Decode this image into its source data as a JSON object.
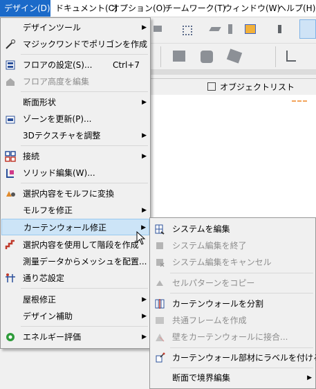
{
  "menubar": [
    {
      "label": "デザイン(D)",
      "active": true
    },
    {
      "label": "ドキュメント(C)"
    },
    {
      "label": "オプション(O)"
    },
    {
      "label": "チームワーク(T)"
    },
    {
      "label": "ウィンドウ(W)"
    },
    {
      "label": "ヘルプ(H)"
    }
  ],
  "background": {
    "object_list_label": "オブジェクトリスト"
  },
  "design_menu": {
    "items": [
      {
        "label": "デザインツール",
        "submenu": true,
        "icon": "none"
      },
      {
        "label": "マジックワンドでポリゴンを作成",
        "icon": "magic-wand-icon"
      },
      {
        "label": "フロアの設定(S)...",
        "shortcut": "Ctrl+7",
        "icon": "floor-settings-icon"
      },
      {
        "label": "フロア高度を編集",
        "disabled": true,
        "icon": "floor-height-icon"
      },
      {
        "label": "断面形状",
        "submenu": true,
        "icon": "none"
      },
      {
        "label": "ゾーンを更新(P)...",
        "icon": "zone-update-icon"
      },
      {
        "label": "3Dテクスチャを調整",
        "submenu": true,
        "icon": "none"
      },
      {
        "label": "接続",
        "submenu": true,
        "icon": "connect-icon"
      },
      {
        "label": "ソリッド編集(W)...",
        "icon": "solid-edit-icon"
      },
      {
        "label": "選択内容をモルフに変換",
        "icon": "convert-morph-icon"
      },
      {
        "label": "モルフを修正",
        "submenu": true,
        "icon": "none"
      },
      {
        "label": "カーテンウォール修正",
        "submenu": true,
        "highlighted": true,
        "icon": "none"
      },
      {
        "label": "選択内容を使用して階段を作成",
        "icon": "stair-icon"
      },
      {
        "label": "測量データからメッシュを配置...",
        "icon": "none"
      },
      {
        "label": "通り芯設定",
        "icon": "grid-settings-icon"
      },
      {
        "label": "屋根修正",
        "submenu": true,
        "icon": "none"
      },
      {
        "label": "デザイン補助",
        "submenu": true,
        "icon": "none"
      },
      {
        "label": "エネルギー評価",
        "submenu": true,
        "icon": "energy-icon"
      }
    ]
  },
  "curtain_wall_menu": {
    "items": [
      {
        "label": "システムを編集",
        "icon": "edit-system-icon"
      },
      {
        "label": "システム編集を終了",
        "disabled": true,
        "icon": "end-edit-icon"
      },
      {
        "label": "システム編集をキャンセル",
        "disabled": true,
        "icon": "cancel-edit-icon"
      },
      {
        "label": "セルパターンをコピー",
        "disabled": true,
        "icon": "copy-pattern-icon"
      },
      {
        "label": "カーテンウォールを分割",
        "icon": "split-wall-icon"
      },
      {
        "label": "共通フレームを作成",
        "disabled": true,
        "icon": "common-frame-icon"
      },
      {
        "label": "壁をカーテンウォールに接合...",
        "disabled": true,
        "icon": "join-wall-icon"
      },
      {
        "label": "カーテンウォール部材にラベルを付ける",
        "icon": "label-member-icon"
      },
      {
        "label": "断面で境界編集",
        "submenu": true,
        "icon": "none"
      }
    ]
  }
}
